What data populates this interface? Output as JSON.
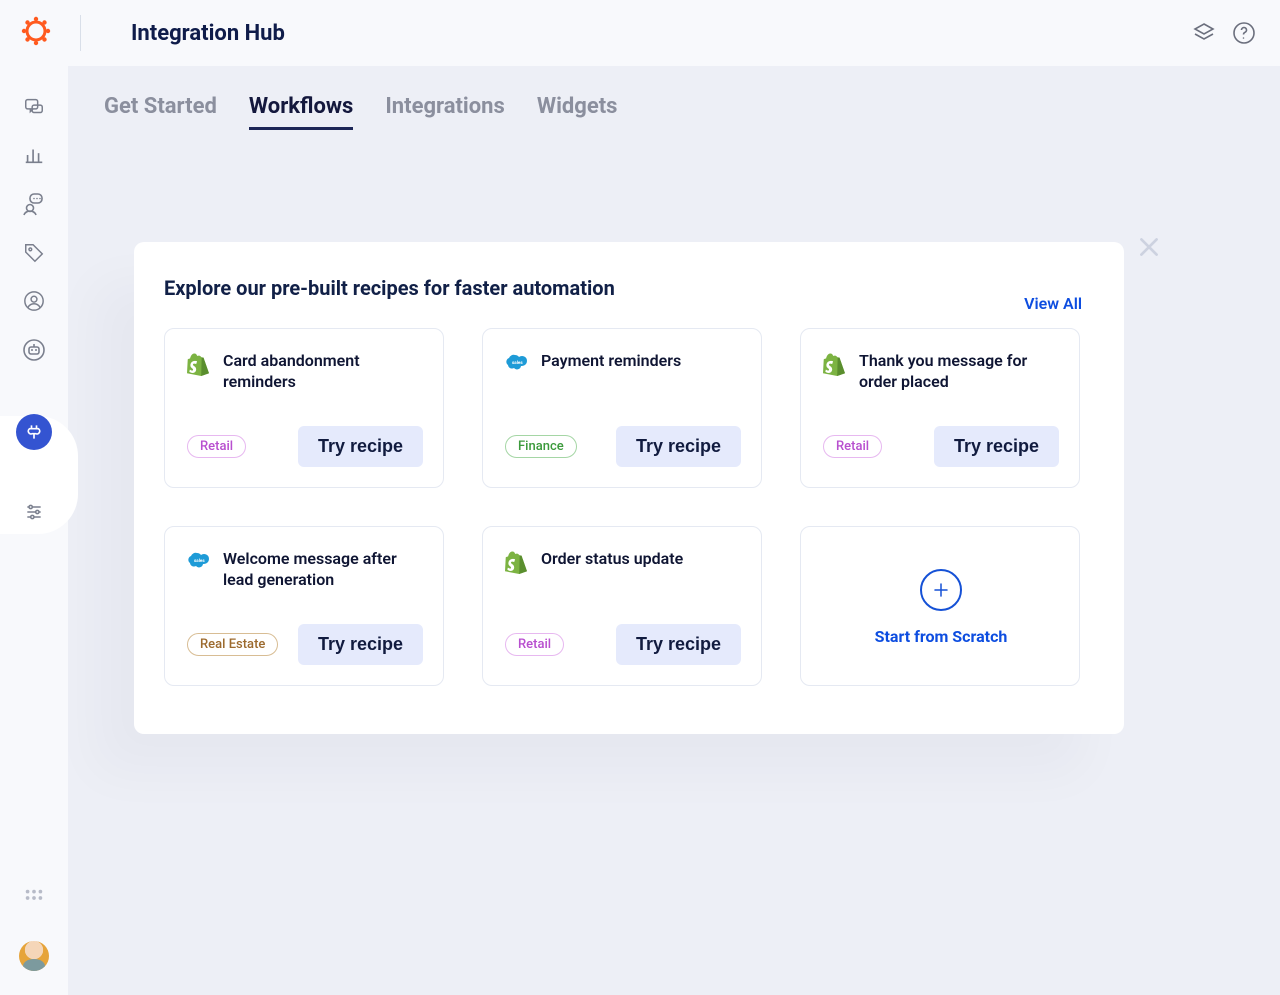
{
  "header": {
    "title": "Integration Hub"
  },
  "rail": {
    "items": [
      "chat",
      "analytics",
      "people-chat",
      "tag",
      "user-circle",
      "bot"
    ],
    "active": "integrations",
    "extra": "sliders"
  },
  "tabs": [
    {
      "label": "Get Started",
      "active": false
    },
    {
      "label": "Workflows",
      "active": true
    },
    {
      "label": "Integrations",
      "active": false
    },
    {
      "label": "Widgets",
      "active": false
    }
  ],
  "panel": {
    "title": "Explore our pre-built recipes for faster automation",
    "view_all": "View All",
    "try_label": "Try recipe",
    "scratch_label": "Start from Scratch",
    "cards": [
      {
        "icon": "shopify",
        "title": "Card abandonment reminders",
        "tag": "Retail",
        "tag_class": "retail"
      },
      {
        "icon": "salesforce",
        "title": "Payment reminders",
        "tag": "Finance",
        "tag_class": "finance"
      },
      {
        "icon": "shopify",
        "title": "Thank you message for order placed",
        "tag": "Retail",
        "tag_class": "retail"
      },
      {
        "icon": "salesforce",
        "title": "Welcome message after lead generation",
        "tag": "Real Estate",
        "tag_class": "realestate"
      },
      {
        "icon": "shopify",
        "title": "Order status update",
        "tag": "Retail",
        "tag_class": "retail"
      }
    ]
  }
}
